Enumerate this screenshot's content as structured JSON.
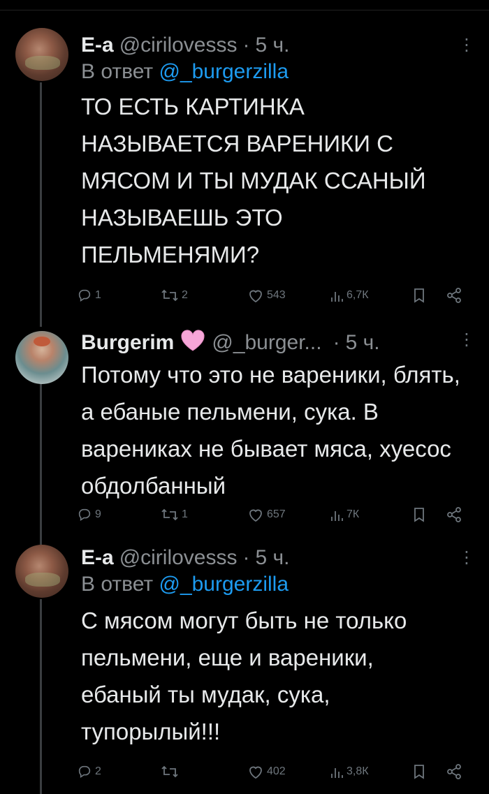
{
  "tweets": [
    {
      "name": "E-a",
      "handle": "@cirilovesss",
      "dot": "·",
      "time": "5 ч.",
      "reply_prefix": "В ответ ",
      "reply_mention": "@_burgerzilla",
      "text": "ТО ЕСТЬ КАРТИНКА НАЗЫВАЕТСЯ ВАРЕНИКИ С МЯСОМ И ТЫ МУДАК ССАНЫЙ НАЗЫВАЕШЬ ЭТО ПЕЛЬМЕНЯМИ?",
      "replies": "1",
      "retweets": "2",
      "likes": "543",
      "views": "6,7К"
    },
    {
      "name": "Burgerim",
      "handle": "@_burger...",
      "dot": "·",
      "time": "5 ч.",
      "text": "Потому что это не вареники, блять, а ебаные пельмени, сука. В варениках не бывает мяса, хуесос обдолбанный",
      "replies": "9",
      "retweets": "1",
      "likes": "657",
      "views": "7К"
    },
    {
      "name": "E-a",
      "handle": "@cirilovesss",
      "dot": "·",
      "time": "5 ч.",
      "reply_prefix": "В ответ ",
      "reply_mention": "@_burgerzilla",
      "text": "С мясом могут быть не только пельмени, еще и вареники, ебаный ты мудак, сука, тупорылый!!!",
      "replies": "2",
      "retweets": "",
      "likes": "402",
      "views": "3,8К"
    }
  ],
  "icons": {
    "more": "more-vertical-icon",
    "reply": "reply-icon",
    "retweet": "retweet-icon",
    "like": "like-icon",
    "views": "views-icon",
    "bookmark": "bookmark-icon",
    "share": "share-icon",
    "heart_emoji": "pink-heart-icon"
  },
  "colors": {
    "background": "#000000",
    "text": "#e7e9ea",
    "muted": "#8b8f93",
    "link": "#1d9bf0",
    "heart": "#f7a6d8"
  }
}
